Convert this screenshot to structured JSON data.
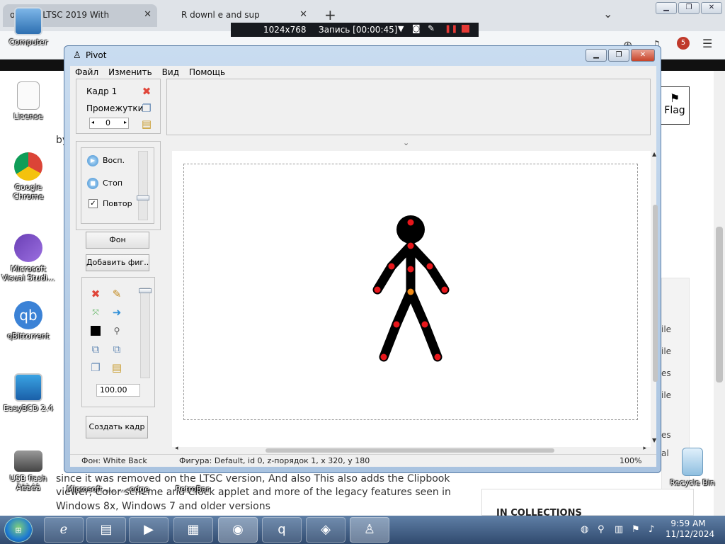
{
  "browser": {
    "tabs": [
      {
        "label": "ows 10 LTSC 2019 With"
      },
      {
        "label": "R downl   e and sup"
      }
    ],
    "new_tab": "+",
    "chevron": "⌄"
  },
  "recorder": {
    "resolution": "1024x768",
    "recording": "Запись [00:00:45]"
  },
  "webpage": {
    "flag_label": "Flag",
    "body_lines": [
      "since it was removed on the LTSC version, And also This also adds the Clipbook",
      "viewer, Color scheme and Clock applet and more of the legacy features seen in",
      "Windows 8x, Windows 7 and older versions"
    ],
    "by_text": "by",
    "collections": "IN COLLECTIONS",
    "side_items": [
      "ile",
      "ile",
      "es",
      "ile",
      "es",
      "al"
    ]
  },
  "desktop": {
    "icons": [
      {
        "label": "Computer"
      },
      {
        "label": "License"
      },
      {
        "label": "Google Chrome"
      },
      {
        "label": "Microsoft Visual Studi..."
      },
      {
        "label": "qBittorrent"
      },
      {
        "label": "EasyBCD 2.4"
      },
      {
        "label": "USB flash Äëàéâ"
      },
      {
        "label": "Microsoft ...."
      },
      {
        "label": "...-edge"
      },
      {
        "label": "RetroBar"
      },
      {
        "label": "Recycle Bin"
      }
    ]
  },
  "pivot": {
    "title": "Pivot",
    "menu": [
      "Файл",
      "Изменить",
      "Вид",
      "Помощь"
    ],
    "frame": {
      "frame_label": "Кадр 1",
      "interval_label": "Промежутки",
      "interval_value": "0"
    },
    "playback": {
      "play": "Восп.",
      "stop": "Стоп",
      "loop": "Повтор"
    },
    "buttons": {
      "background": "Фон",
      "add_figure": "Добавить фиг...",
      "create_frame": "Создать кадр"
    },
    "scale_value": "100.00",
    "status": {
      "background": "Фон: White Back",
      "figure": "Фигура: Default,  id 0,  z-порядок 1,  x 320, y 180",
      "zoom": "100%"
    }
  },
  "taskbar": {
    "time": "9:59 AM",
    "date": "11/12/2024"
  },
  "colors": {
    "figure": "#000000",
    "joint": "#e8161b",
    "center_joint": "#f08a16",
    "window_frame": "#a9c3e0",
    "taskbar": "#304a6e"
  }
}
